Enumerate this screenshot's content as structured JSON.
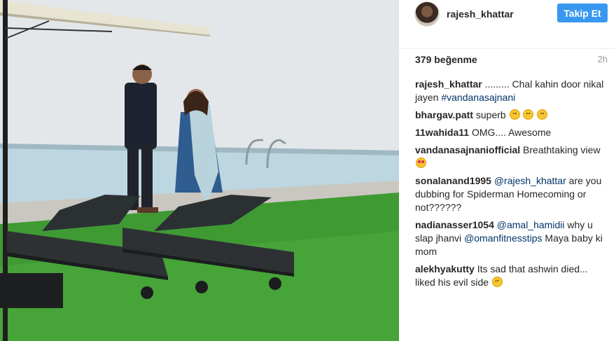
{
  "header": {
    "username": "rajesh_khattar",
    "follow_label": "Takip Et"
  },
  "post": {
    "likes": "379 beğenme",
    "time": "2h"
  },
  "comments": [
    {
      "author": "rajesh_khattar",
      "text": " ......... Chal kahin door nikal jayen ",
      "link": "#vandanasajnani",
      "after": "",
      "emoji": []
    },
    {
      "author": "bhargav.patt",
      "text": " superb ",
      "link": "",
      "after": "",
      "emoji": [
        "smile-icon",
        "smile-icon",
        "smile-icon"
      ]
    },
    {
      "author": "11wahida11",
      "text": " OMG.... Awesome",
      "link": "",
      "after": "",
      "emoji": []
    },
    {
      "author": "vandanasajnaniofficial",
      "text": " Breathtaking view ",
      "link": "",
      "after": "",
      "emoji": [
        "heart-eyes-icon"
      ]
    },
    {
      "author": "sonalanand1995",
      "text": " ",
      "link": "@rajesh_khattar",
      "after": " are you dubbing for Spiderman Homecoming or not??????",
      "emoji": []
    },
    {
      "author": "nadianasser1054",
      "text": " ",
      "link": "@amal_hamidii",
      "after": " why u slap jhanvi ",
      "link2": "@omanfitnesstips",
      "after2": " Maya baby ki mom",
      "emoji": []
    },
    {
      "author": "alekhyakutty",
      "text": " Its sad that ashwin died... liked his evil side ",
      "link": "",
      "after": "",
      "emoji": [
        "weary-face-icon"
      ]
    }
  ]
}
